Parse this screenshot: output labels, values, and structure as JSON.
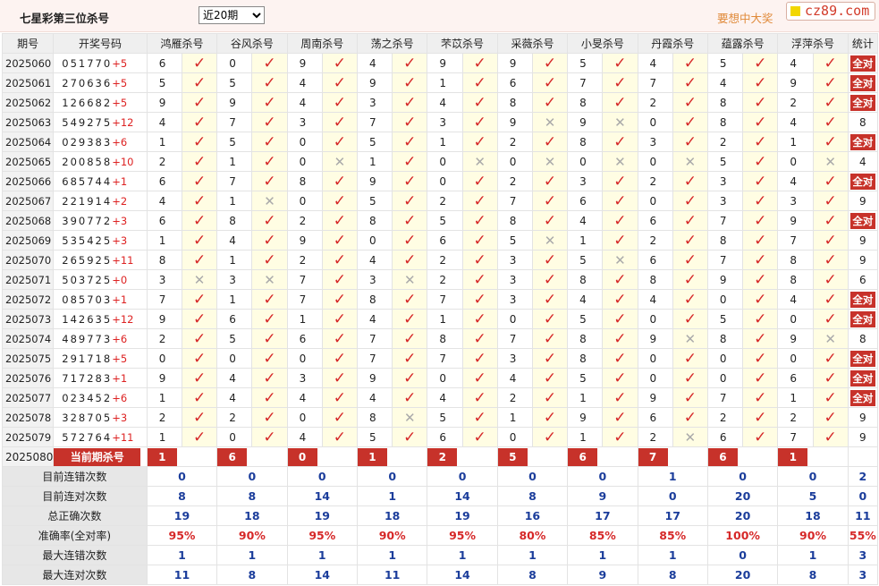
{
  "header": {
    "title": "七星彩第三位杀号",
    "period_select": "近20期",
    "promo": "要想中大奖",
    "logo": "cz89.com"
  },
  "columns": [
    "期号",
    "开奖号码",
    "鸿雁杀号",
    "谷风杀号",
    "周南杀号",
    "荡之杀号",
    "芣苡杀号",
    "采薇杀号",
    "小旻杀号",
    "丹霞杀号",
    "蕴露杀号",
    "浮萍杀号",
    "统计"
  ],
  "rows": [
    {
      "issue": "2025060",
      "digits": "051770",
      "sum": "+5",
      "kills": [
        {
          "n": "6",
          "r": true
        },
        {
          "n": "0",
          "r": true
        },
        {
          "n": "9",
          "r": true
        },
        {
          "n": "4",
          "r": true
        },
        {
          "n": "9",
          "r": true
        },
        {
          "n": "9",
          "r": true
        },
        {
          "n": "5",
          "r": true
        },
        {
          "n": "4",
          "r": true
        },
        {
          "n": "5",
          "r": true
        },
        {
          "n": "4",
          "r": true
        }
      ],
      "stat": "全对"
    },
    {
      "issue": "2025061",
      "digits": "270636",
      "sum": "+5",
      "kills": [
        {
          "n": "5",
          "r": true
        },
        {
          "n": "5",
          "r": true
        },
        {
          "n": "4",
          "r": true
        },
        {
          "n": "9",
          "r": true
        },
        {
          "n": "1",
          "r": true
        },
        {
          "n": "6",
          "r": true
        },
        {
          "n": "7",
          "r": true
        },
        {
          "n": "7",
          "r": true
        },
        {
          "n": "4",
          "r": true
        },
        {
          "n": "9",
          "r": true
        }
      ],
      "stat": "全对"
    },
    {
      "issue": "2025062",
      "digits": "126682",
      "sum": "+5",
      "kills": [
        {
          "n": "9",
          "r": true
        },
        {
          "n": "9",
          "r": true
        },
        {
          "n": "4",
          "r": true
        },
        {
          "n": "3",
          "r": true
        },
        {
          "n": "4",
          "r": true
        },
        {
          "n": "8",
          "r": true
        },
        {
          "n": "8",
          "r": true
        },
        {
          "n": "2",
          "r": true
        },
        {
          "n": "8",
          "r": true
        },
        {
          "n": "2",
          "r": true
        }
      ],
      "stat": "全对"
    },
    {
      "issue": "2025063",
      "digits": "549275",
      "sum": "+12",
      "kills": [
        {
          "n": "4",
          "r": true
        },
        {
          "n": "7",
          "r": true
        },
        {
          "n": "3",
          "r": true
        },
        {
          "n": "7",
          "r": true
        },
        {
          "n": "3",
          "r": true
        },
        {
          "n": "9",
          "r": false
        },
        {
          "n": "9",
          "r": false
        },
        {
          "n": "0",
          "r": true
        },
        {
          "n": "8",
          "r": true
        },
        {
          "n": "4",
          "r": true
        }
      ],
      "stat": "8"
    },
    {
      "issue": "2025064",
      "digits": "029383",
      "sum": "+6",
      "kills": [
        {
          "n": "1",
          "r": true
        },
        {
          "n": "5",
          "r": true
        },
        {
          "n": "0",
          "r": true
        },
        {
          "n": "5",
          "r": true
        },
        {
          "n": "1",
          "r": true
        },
        {
          "n": "2",
          "r": true
        },
        {
          "n": "8",
          "r": true
        },
        {
          "n": "3",
          "r": true
        },
        {
          "n": "2",
          "r": true
        },
        {
          "n": "1",
          "r": true
        }
      ],
      "stat": "全对"
    },
    {
      "issue": "2025065",
      "digits": "200858",
      "sum": "+10",
      "kills": [
        {
          "n": "2",
          "r": true
        },
        {
          "n": "1",
          "r": true
        },
        {
          "n": "0",
          "r": false
        },
        {
          "n": "1",
          "r": true
        },
        {
          "n": "0",
          "r": false
        },
        {
          "n": "0",
          "r": false
        },
        {
          "n": "0",
          "r": false
        },
        {
          "n": "0",
          "r": false
        },
        {
          "n": "5",
          "r": true
        },
        {
          "n": "0",
          "r": false
        }
      ],
      "stat": "4"
    },
    {
      "issue": "2025066",
      "digits": "685744",
      "sum": "+1",
      "kills": [
        {
          "n": "6",
          "r": true
        },
        {
          "n": "7",
          "r": true
        },
        {
          "n": "8",
          "r": true
        },
        {
          "n": "9",
          "r": true
        },
        {
          "n": "0",
          "r": true
        },
        {
          "n": "2",
          "r": true
        },
        {
          "n": "3",
          "r": true
        },
        {
          "n": "2",
          "r": true
        },
        {
          "n": "3",
          "r": true
        },
        {
          "n": "4",
          "r": true
        }
      ],
      "stat": "全对"
    },
    {
      "issue": "2025067",
      "digits": "221914",
      "sum": "+2",
      "kills": [
        {
          "n": "4",
          "r": true
        },
        {
          "n": "1",
          "r": false
        },
        {
          "n": "0",
          "r": true
        },
        {
          "n": "5",
          "r": true
        },
        {
          "n": "2",
          "r": true
        },
        {
          "n": "7",
          "r": true
        },
        {
          "n": "6",
          "r": true
        },
        {
          "n": "0",
          "r": true
        },
        {
          "n": "3",
          "r": true
        },
        {
          "n": "3",
          "r": true
        }
      ],
      "stat": "9"
    },
    {
      "issue": "2025068",
      "digits": "390772",
      "sum": "+3",
      "kills": [
        {
          "n": "6",
          "r": true
        },
        {
          "n": "8",
          "r": true
        },
        {
          "n": "2",
          "r": true
        },
        {
          "n": "8",
          "r": true
        },
        {
          "n": "5",
          "r": true
        },
        {
          "n": "8",
          "r": true
        },
        {
          "n": "4",
          "r": true
        },
        {
          "n": "6",
          "r": true
        },
        {
          "n": "7",
          "r": true
        },
        {
          "n": "9",
          "r": true
        }
      ],
      "stat": "全对"
    },
    {
      "issue": "2025069",
      "digits": "535425",
      "sum": "+3",
      "kills": [
        {
          "n": "1",
          "r": true
        },
        {
          "n": "4",
          "r": true
        },
        {
          "n": "9",
          "r": true
        },
        {
          "n": "0",
          "r": true
        },
        {
          "n": "6",
          "r": true
        },
        {
          "n": "5",
          "r": false
        },
        {
          "n": "1",
          "r": true
        },
        {
          "n": "2",
          "r": true
        },
        {
          "n": "8",
          "r": true
        },
        {
          "n": "7",
          "r": true
        }
      ],
      "stat": "9"
    },
    {
      "issue": "2025070",
      "digits": "265925",
      "sum": "+11",
      "kills": [
        {
          "n": "8",
          "r": true
        },
        {
          "n": "1",
          "r": true
        },
        {
          "n": "2",
          "r": true
        },
        {
          "n": "4",
          "r": true
        },
        {
          "n": "2",
          "r": true
        },
        {
          "n": "3",
          "r": true
        },
        {
          "n": "5",
          "r": false
        },
        {
          "n": "6",
          "r": true
        },
        {
          "n": "7",
          "r": true
        },
        {
          "n": "8",
          "r": true
        }
      ],
      "stat": "9"
    },
    {
      "issue": "2025071",
      "digits": "503725",
      "sum": "+0",
      "kills": [
        {
          "n": "3",
          "r": false
        },
        {
          "n": "3",
          "r": false
        },
        {
          "n": "7",
          "r": true
        },
        {
          "n": "3",
          "r": false
        },
        {
          "n": "2",
          "r": true
        },
        {
          "n": "3",
          "r": true
        },
        {
          "n": "8",
          "r": true
        },
        {
          "n": "8",
          "r": true
        },
        {
          "n": "9",
          "r": true
        },
        {
          "n": "8",
          "r": true
        }
      ],
      "stat": "6"
    },
    {
      "issue": "2025072",
      "digits": "085703",
      "sum": "+1",
      "kills": [
        {
          "n": "7",
          "r": true
        },
        {
          "n": "1",
          "r": true
        },
        {
          "n": "7",
          "r": true
        },
        {
          "n": "8",
          "r": true
        },
        {
          "n": "7",
          "r": true
        },
        {
          "n": "3",
          "r": true
        },
        {
          "n": "4",
          "r": true
        },
        {
          "n": "4",
          "r": true
        },
        {
          "n": "0",
          "r": true
        },
        {
          "n": "4",
          "r": true
        }
      ],
      "stat": "全对"
    },
    {
      "issue": "2025073",
      "digits": "142635",
      "sum": "+12",
      "kills": [
        {
          "n": "9",
          "r": true
        },
        {
          "n": "6",
          "r": true
        },
        {
          "n": "1",
          "r": true
        },
        {
          "n": "4",
          "r": true
        },
        {
          "n": "1",
          "r": true
        },
        {
          "n": "0",
          "r": true
        },
        {
          "n": "5",
          "r": true
        },
        {
          "n": "0",
          "r": true
        },
        {
          "n": "5",
          "r": true
        },
        {
          "n": "0",
          "r": true
        }
      ],
      "stat": "全对"
    },
    {
      "issue": "2025074",
      "digits": "489773",
      "sum": "+6",
      "kills": [
        {
          "n": "2",
          "r": true
        },
        {
          "n": "5",
          "r": true
        },
        {
          "n": "6",
          "r": true
        },
        {
          "n": "7",
          "r": true
        },
        {
          "n": "8",
          "r": true
        },
        {
          "n": "7",
          "r": true
        },
        {
          "n": "8",
          "r": true
        },
        {
          "n": "9",
          "r": false
        },
        {
          "n": "8",
          "r": true
        },
        {
          "n": "9",
          "r": false
        }
      ],
      "stat": "8"
    },
    {
      "issue": "2025075",
      "digits": "291718",
      "sum": "+5",
      "kills": [
        {
          "n": "0",
          "r": true
        },
        {
          "n": "0",
          "r": true
        },
        {
          "n": "0",
          "r": true
        },
        {
          "n": "7",
          "r": true
        },
        {
          "n": "7",
          "r": true
        },
        {
          "n": "3",
          "r": true
        },
        {
          "n": "8",
          "r": true
        },
        {
          "n": "0",
          "r": true
        },
        {
          "n": "0",
          "r": true
        },
        {
          "n": "0",
          "r": true
        }
      ],
      "stat": "全对"
    },
    {
      "issue": "2025076",
      "digits": "717283",
      "sum": "+1",
      "kills": [
        {
          "n": "9",
          "r": true
        },
        {
          "n": "4",
          "r": true
        },
        {
          "n": "3",
          "r": true
        },
        {
          "n": "9",
          "r": true
        },
        {
          "n": "0",
          "r": true
        },
        {
          "n": "4",
          "r": true
        },
        {
          "n": "5",
          "r": true
        },
        {
          "n": "0",
          "r": true
        },
        {
          "n": "0",
          "r": true
        },
        {
          "n": "6",
          "r": true
        }
      ],
      "stat": "全对"
    },
    {
      "issue": "2025077",
      "digits": "023452",
      "sum": "+6",
      "kills": [
        {
          "n": "1",
          "r": true
        },
        {
          "n": "4",
          "r": true
        },
        {
          "n": "4",
          "r": true
        },
        {
          "n": "4",
          "r": true
        },
        {
          "n": "4",
          "r": true
        },
        {
          "n": "2",
          "r": true
        },
        {
          "n": "1",
          "r": true
        },
        {
          "n": "9",
          "r": true
        },
        {
          "n": "7",
          "r": true
        },
        {
          "n": "1",
          "r": true
        }
      ],
      "stat": "全对"
    },
    {
      "issue": "2025078",
      "digits": "328705",
      "sum": "+3",
      "kills": [
        {
          "n": "2",
          "r": true
        },
        {
          "n": "2",
          "r": true
        },
        {
          "n": "0",
          "r": true
        },
        {
          "n": "8",
          "r": false
        },
        {
          "n": "5",
          "r": true
        },
        {
          "n": "1",
          "r": true
        },
        {
          "n": "9",
          "r": true
        },
        {
          "n": "6",
          "r": true
        },
        {
          "n": "2",
          "r": true
        },
        {
          "n": "2",
          "r": true
        }
      ],
      "stat": "9"
    },
    {
      "issue": "2025079",
      "digits": "572764",
      "sum": "+11",
      "kills": [
        {
          "n": "1",
          "r": true
        },
        {
          "n": "0",
          "r": true
        },
        {
          "n": "4",
          "r": true
        },
        {
          "n": "5",
          "r": true
        },
        {
          "n": "6",
          "r": true
        },
        {
          "n": "0",
          "r": true
        },
        {
          "n": "1",
          "r": true
        },
        {
          "n": "2",
          "r": false
        },
        {
          "n": "6",
          "r": true
        },
        {
          "n": "7",
          "r": true
        }
      ],
      "stat": "9"
    }
  ],
  "prediction": {
    "issue": "2025080",
    "label": "当前期杀号",
    "values": [
      "1",
      "6",
      "0",
      "1",
      "2",
      "5",
      "6",
      "7",
      "6",
      "1"
    ]
  },
  "summary": [
    {
      "label": "目前连错次数",
      "values": [
        "0",
        "0",
        "0",
        "0",
        "0",
        "0",
        "0",
        "1",
        "0",
        "0"
      ],
      "total": "2"
    },
    {
      "label": "目前连对次数",
      "values": [
        "8",
        "8",
        "14",
        "1",
        "14",
        "8",
        "9",
        "0",
        "20",
        "5"
      ],
      "total": "0"
    },
    {
      "label": "总正确次数",
      "values": [
        "19",
        "18",
        "19",
        "18",
        "19",
        "16",
        "17",
        "17",
        "20",
        "18"
      ],
      "total": "11"
    },
    {
      "label": "准确率(全对率)",
      "values": [
        "95%",
        "90%",
        "95%",
        "90%",
        "95%",
        "80%",
        "85%",
        "85%",
        "100%",
        "90%"
      ],
      "total": "55%"
    },
    {
      "label": "最大连错次数",
      "values": [
        "1",
        "1",
        "1",
        "1",
        "1",
        "1",
        "1",
        "1",
        "0",
        "1"
      ],
      "total": "3"
    },
    {
      "label": "最大连对次数",
      "values": [
        "11",
        "8",
        "14",
        "11",
        "14",
        "8",
        "9",
        "8",
        "20",
        "8"
      ],
      "total": "3"
    }
  ],
  "icons": {
    "right": "check-icon",
    "wrong": "cross-icon"
  },
  "colors": {
    "accent": "#c7322a",
    "right": "#d62828",
    "value_blue": "#1b3d9b",
    "highlight": "#fffde3"
  }
}
